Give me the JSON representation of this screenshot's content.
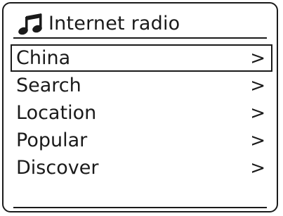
{
  "header": {
    "icon": "music-note-icon",
    "title": "Internet radio"
  },
  "menu": {
    "selected_index": 0,
    "items": [
      {
        "label": "China",
        "chevron": ">"
      },
      {
        "label": "Search",
        "chevron": ">"
      },
      {
        "label": "Location",
        "chevron": ">"
      },
      {
        "label": "Popular",
        "chevron": ">"
      },
      {
        "label": "Discover",
        "chevron": ">"
      }
    ]
  },
  "colors": {
    "foreground": "#1a1a1a",
    "background": "#ffffff"
  }
}
